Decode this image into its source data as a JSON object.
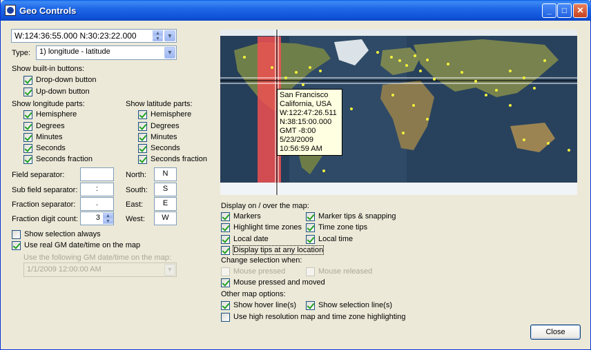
{
  "window": {
    "title": "Geo Controls"
  },
  "coord_field": {
    "value": "W:124:36:55.000   N:30:23:22.000"
  },
  "type": {
    "label": "Type:",
    "value": "1) longitude - latitude"
  },
  "builtin": {
    "heading": "Show built-in buttons:",
    "dropdown": {
      "label": "Drop-down button",
      "checked": true
    },
    "updown": {
      "label": "Up-down button",
      "checked": true
    }
  },
  "longitude_parts": {
    "heading": "Show longitude parts:",
    "items": [
      {
        "label": "Hemisphere",
        "checked": true
      },
      {
        "label": "Degrees",
        "checked": true
      },
      {
        "label": "Minutes",
        "checked": true
      },
      {
        "label": "Seconds",
        "checked": true
      },
      {
        "label": "Seconds fraction",
        "checked": true
      }
    ]
  },
  "latitude_parts": {
    "heading": "Show latitude parts:",
    "items": [
      {
        "label": "Hemisphere",
        "checked": true
      },
      {
        "label": "Degrees",
        "checked": true
      },
      {
        "label": "Minutes",
        "checked": true
      },
      {
        "label": "Seconds",
        "checked": true
      },
      {
        "label": "Seconds fraction",
        "checked": true
      }
    ]
  },
  "separators": {
    "field": {
      "label": "Field separator:",
      "value": ""
    },
    "sub_field": {
      "label": "Sub field separator:",
      "value": ":"
    },
    "fraction": {
      "label": "Fraction separator:",
      "value": "."
    },
    "digit_count": {
      "label": "Fraction digit count:",
      "value": "3"
    }
  },
  "hemispheres": {
    "north": {
      "label": "North:",
      "value": "N"
    },
    "south": {
      "label": "South:",
      "value": "S"
    },
    "east": {
      "label": "East:",
      "value": "E"
    },
    "west": {
      "label": "West:",
      "value": "W"
    }
  },
  "selection_always": {
    "label": "Show selection always",
    "checked": false
  },
  "real_gm": {
    "label": "Use real GM date/time on the map",
    "checked": true
  },
  "gm_datetime": {
    "label": "Use the following GM date/time on the map:",
    "value": "1/1/2009  12:00:00 AM"
  },
  "map_tooltip": {
    "lines": [
      "San Francisco",
      "California, USA",
      "W:122:47:26.511",
      "N:38:15:00.000",
      "GMT -8:00",
      "5/23/2009",
      "10:56:59 AM"
    ]
  },
  "display": {
    "heading": "Display on / over the map:",
    "markers": {
      "label": "Markers",
      "checked": true
    },
    "marker_tips": {
      "label": "Marker tips & snapping",
      "checked": true
    },
    "highlight_tz": {
      "label": "Highlight time zones",
      "checked": true
    },
    "tz_tips": {
      "label": "Time zone tips",
      "checked": true
    },
    "local_date": {
      "label": "Local date",
      "checked": true
    },
    "local_time": {
      "label": "Local time",
      "checked": true
    },
    "tips_any": {
      "label": "Display tips at any location",
      "checked": true
    }
  },
  "change_sel": {
    "heading": "Change selection when:",
    "pressed": {
      "label": "Mouse pressed",
      "checked": false
    },
    "released": {
      "label": "Mouse released",
      "checked": false
    },
    "pressed_moved": {
      "label": "Mouse pressed and moved",
      "checked": true
    }
  },
  "other": {
    "heading": "Other map options:",
    "hover": {
      "label": "Show hover line(s)",
      "checked": true
    },
    "selection_lines": {
      "label": "Show selection line(s)",
      "checked": true
    },
    "hires": {
      "label": "Use high resolution map and time zone highlighting",
      "checked": false
    }
  },
  "close_button": {
    "label": "Close"
  },
  "colors": {
    "ocean": "#2F4A66",
    "land": "#6F7F4A",
    "marker": "#F4F43C",
    "tooltip": "#FFFFE1",
    "timezone": "#F05050"
  }
}
